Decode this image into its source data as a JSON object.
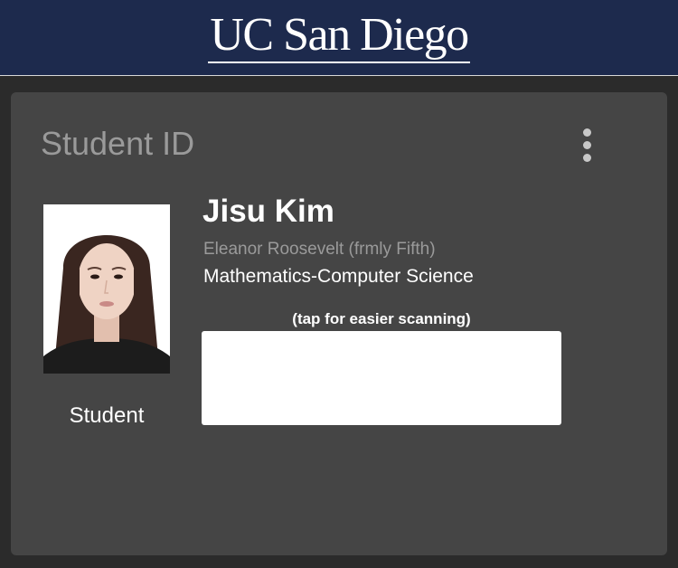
{
  "header": {
    "logo_text": "UC San Diego"
  },
  "card": {
    "title": "Student ID",
    "menu_icon": "vertical-ellipsis-icon",
    "photo": "student-portrait",
    "role": "Student",
    "name": "Jisu Kim",
    "college": "Eleanor Roosevelt (frmly Fifth)",
    "major": "Mathematics-Computer Science",
    "scan_hint": "(tap for easier scanning)"
  },
  "colors": {
    "header_bg": "#1d2a4d",
    "page_bg": "#2b2b2b",
    "card_bg": "#454545",
    "muted_text": "#9a9a9a",
    "text": "#ffffff"
  }
}
